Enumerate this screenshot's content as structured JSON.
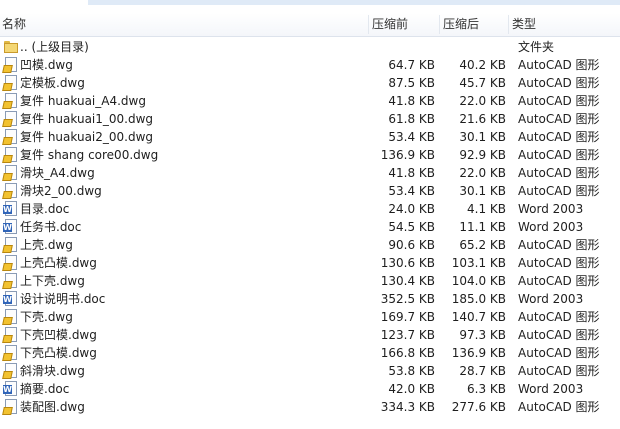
{
  "columns": {
    "name": "名称",
    "size": "压缩前",
    "compressed": "压缩后",
    "type": "类型"
  },
  "rows": [
    {
      "icon": "folder-icon",
      "name": ".. (上级目录)",
      "size": "",
      "compressed": "",
      "type": "文件夹"
    },
    {
      "icon": "dwg-file-icon",
      "name": "凹模.dwg",
      "size": "64.7 KB",
      "compressed": "40.2 KB",
      "type": "AutoCAD 图形"
    },
    {
      "icon": "dwg-file-icon",
      "name": "定模板.dwg",
      "size": "87.5 KB",
      "compressed": "45.7 KB",
      "type": "AutoCAD 图形"
    },
    {
      "icon": "dwg-file-icon",
      "name": "复件 huakuai_A4.dwg",
      "size": "41.8 KB",
      "compressed": "22.0 KB",
      "type": "AutoCAD 图形"
    },
    {
      "icon": "dwg-file-icon",
      "name": "复件 huakuai1_00.dwg",
      "size": "61.8 KB",
      "compressed": "21.6 KB",
      "type": "AutoCAD 图形"
    },
    {
      "icon": "dwg-file-icon",
      "name": "复件 huakuai2_00.dwg",
      "size": "53.4 KB",
      "compressed": "30.1 KB",
      "type": "AutoCAD 图形"
    },
    {
      "icon": "dwg-file-icon",
      "name": "复件 shang core00.dwg",
      "size": "136.9 KB",
      "compressed": "92.9 KB",
      "type": "AutoCAD 图形"
    },
    {
      "icon": "dwg-file-icon",
      "name": "滑块_A4.dwg",
      "size": "41.8 KB",
      "compressed": "22.0 KB",
      "type": "AutoCAD 图形"
    },
    {
      "icon": "dwg-file-icon",
      "name": "滑块2_00.dwg",
      "size": "53.4 KB",
      "compressed": "30.1 KB",
      "type": "AutoCAD 图形"
    },
    {
      "icon": "doc-file-icon",
      "name": "目录.doc",
      "size": "24.0 KB",
      "compressed": "4.1 KB",
      "type": "Word 2003"
    },
    {
      "icon": "doc-file-icon",
      "name": "任务书.doc",
      "size": "54.5 KB",
      "compressed": "11.1 KB",
      "type": "Word 2003"
    },
    {
      "icon": "dwg-file-icon",
      "name": "上壳.dwg",
      "size": "90.6 KB",
      "compressed": "65.2 KB",
      "type": "AutoCAD 图形"
    },
    {
      "icon": "dwg-file-icon",
      "name": "上壳凸模.dwg",
      "size": "130.6 KB",
      "compressed": "103.1 KB",
      "type": "AutoCAD 图形"
    },
    {
      "icon": "dwg-file-icon",
      "name": "上下壳.dwg",
      "size": "130.4 KB",
      "compressed": "104.0 KB",
      "type": "AutoCAD 图形"
    },
    {
      "icon": "doc-file-icon",
      "name": "设计说明书.doc",
      "size": "352.5 KB",
      "compressed": "185.0 KB",
      "type": "Word 2003"
    },
    {
      "icon": "dwg-file-icon",
      "name": "下壳.dwg",
      "size": "169.7 KB",
      "compressed": "140.7 KB",
      "type": "AutoCAD 图形"
    },
    {
      "icon": "dwg-file-icon",
      "name": "下壳凹模.dwg",
      "size": "123.7 KB",
      "compressed": "97.3 KB",
      "type": "AutoCAD 图形"
    },
    {
      "icon": "dwg-file-icon",
      "name": "下壳凸模.dwg",
      "size": "166.8 KB",
      "compressed": "136.9 KB",
      "type": "AutoCAD 图形"
    },
    {
      "icon": "dwg-file-icon",
      "name": "斜滑块.dwg",
      "size": "53.8 KB",
      "compressed": "28.7 KB",
      "type": "AutoCAD 图形"
    },
    {
      "icon": "doc-file-icon",
      "name": "摘要.doc",
      "size": "42.0 KB",
      "compressed": "6.3 KB",
      "type": "Word 2003"
    },
    {
      "icon": "dwg-file-icon",
      "name": "装配图.dwg",
      "size": "334.3 KB",
      "compressed": "277.6 KB",
      "type": "AutoCAD 图形"
    }
  ]
}
